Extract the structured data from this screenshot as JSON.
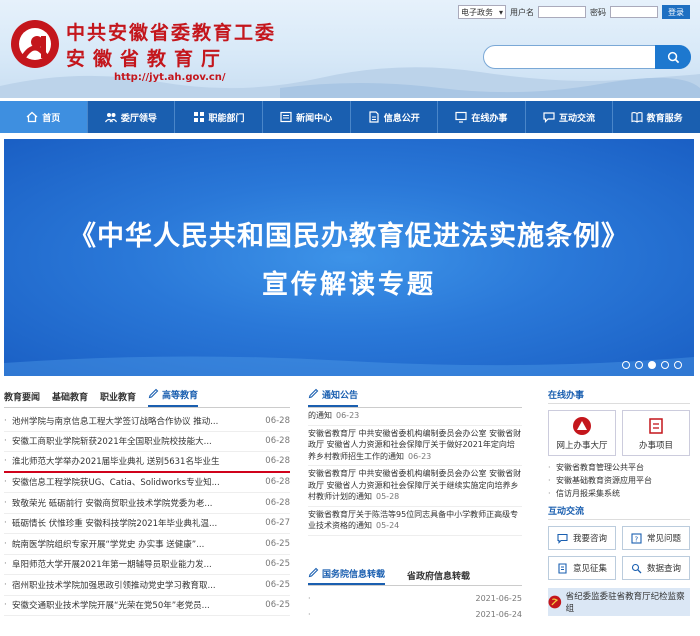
{
  "header": {
    "org_line1": "中共安徽省委教育工委",
    "org_line2": "安徽省教育厅",
    "url": "http://jyt.ah.gov.cn/",
    "login": {
      "select_value": "电子政务",
      "username_label": "用户名",
      "password_label": "密码",
      "login_button": "登录"
    },
    "search_placeholder": ""
  },
  "nav": [
    {
      "label": "首页",
      "icon": "home-icon"
    },
    {
      "label": "委厅领导",
      "icon": "people-icon"
    },
    {
      "label": "职能部门",
      "icon": "grid-icon"
    },
    {
      "label": "新闻中心",
      "icon": "news-icon"
    },
    {
      "label": "信息公开",
      "icon": "doc-icon"
    },
    {
      "label": "在线办事",
      "icon": "monitor-icon"
    },
    {
      "label": "互动交流",
      "icon": "chat-icon"
    },
    {
      "label": "教育服务",
      "icon": "book-icon"
    }
  ],
  "banner": {
    "title_line1": "《中华人民共和国民办教育促进法实施条例》",
    "title_line2": "宣传解读专题",
    "dots_total": 5,
    "dots_active": 2
  },
  "news": {
    "tabs": [
      "教育要闻",
      "基础教育",
      "职业教育",
      "高等教育"
    ],
    "active_tab": 3,
    "items": [
      {
        "title": "池州学院与南京信息工程大学签订战略合作协议 推动...",
        "date": "06-28"
      },
      {
        "title": "安徽工商职业学院斩获2021年全国职业院校技能大...",
        "date": "06-28"
      },
      {
        "title": "淮北师范大学举办2021届毕业典礼 送别5631名毕业生",
        "date": "06-28"
      },
      {
        "title": "安徽信息工程学院获UG、Catia、Solidworks专业知...",
        "date": "06-28"
      },
      {
        "title": "致敬荣光 砥砺前行 安徽商贸职业技术学院党委为老...",
        "date": "06-28"
      },
      {
        "title": "砥砺情长 伏惟珍重 安徽科技学院2021年毕业典礼温...",
        "date": "06-27"
      },
      {
        "title": "皖南医学院组织专家开展“学党史 办实事 送健康”...",
        "date": "06-25"
      },
      {
        "title": "阜阳师范大学开展2021年第一期辅导员职业能力发...",
        "date": "06-25"
      },
      {
        "title": "宿州职业技术学院加强思政引领推动党史学习教育取...",
        "date": "06-25"
      },
      {
        "title": "安徽交通职业技术学院开展“光荣在党50年”老党员...",
        "date": "06-25"
      }
    ]
  },
  "notice": {
    "title": "通知公告",
    "items": [
      {
        "text": "的通知",
        "date": "06-23"
      },
      {
        "text": "安徽省教育厅 中共安徽省委机构编制委员会办公室 安徽省财政厅 安徽省人力资源和社会保障厅关于做好2021年定向培养乡村教师招生工作的通知",
        "date": "06-23"
      },
      {
        "text": "安徽省教育厅 中共安徽省委机构编制委员会办公室 安徽省财政厅 安徽省人力资源和社会保障厅关于继续实施定向培养乡村教师计划的通知",
        "date": "05-28"
      },
      {
        "text": "安徽省教育厅关于陈浩等95位同志具备中小学教师正高级专业技术资格的通知",
        "date": "05-24"
      }
    ]
  },
  "gov": {
    "tabs": [
      "国务院信息转载",
      "省政府信息转载"
    ],
    "items": [
      {
        "text": "",
        "date": "2021-06-25"
      },
      {
        "text": "",
        "date": "2021-06-24"
      }
    ]
  },
  "right": {
    "online_title": "在线办事",
    "services": [
      {
        "label": "网上办事大厅",
        "icon": "hall-icon"
      },
      {
        "label": "办事项目",
        "icon": "list-icon"
      }
    ],
    "links": [
      "安徽省教育管理公共平台",
      "安徽基础教育资源应用平台",
      "信访月报采集系统"
    ],
    "interact_title": "互动交流",
    "buttons": [
      {
        "label": "我要咨询",
        "icon": "consult-icon"
      },
      {
        "label": "常见问题",
        "icon": "faq-icon"
      },
      {
        "label": "意见征集",
        "icon": "opinion-icon"
      },
      {
        "label": "数据查询",
        "icon": "query-icon"
      }
    ],
    "discipline_label": "省纪委监委驻省教育厅纪检监察组"
  },
  "colors": {
    "brand_red": "#c4161c",
    "nav_blue": "#1a5fb0",
    "banner_blue": "#2a78d8"
  }
}
